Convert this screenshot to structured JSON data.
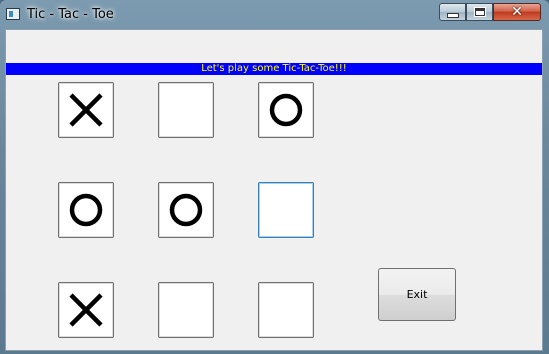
{
  "window": {
    "title": "Tic - Tac - Toe",
    "icon": "app-icon",
    "controls": [
      "minimize-icon",
      "maximize-icon",
      "close-icon"
    ]
  },
  "banner": {
    "text": "Let's play some Tic-Tac-Toe!!!",
    "background": "#0000ff",
    "color": "#ffff00"
  },
  "board": {
    "cells": [
      "X",
      "",
      "O",
      "O",
      "O",
      "",
      "X",
      "",
      ""
    ],
    "focused_cell": 5
  },
  "exit_button": {
    "label": "Exit"
  }
}
